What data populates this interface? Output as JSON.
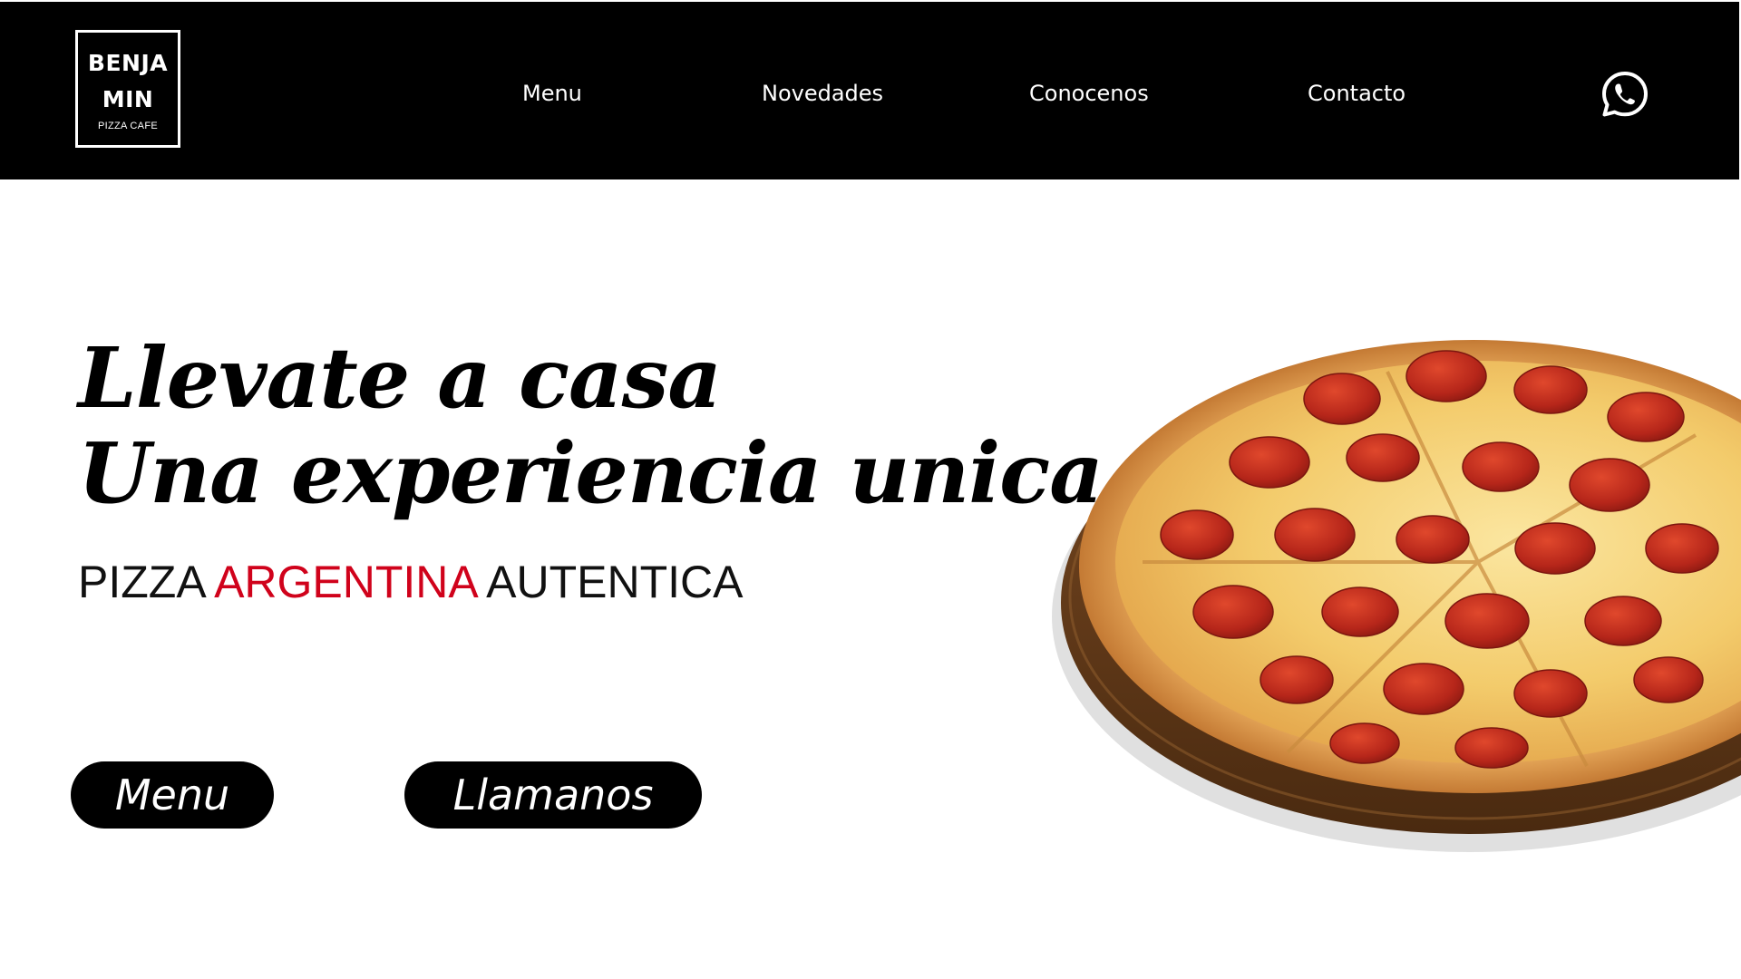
{
  "header": {
    "logo": {
      "line1": "BENJA",
      "line2": "MIN",
      "line3": "PIZZA CAFE"
    },
    "nav": [
      {
        "label": "Menu"
      },
      {
        "label": "Novedades"
      },
      {
        "label": "Conocenos"
      },
      {
        "label": "Contacto"
      }
    ],
    "whatsapp_icon": "whatsapp-icon"
  },
  "hero": {
    "headline_line1": "Llevate a casa",
    "headline_line2": "Una experiencia unica",
    "tagline": {
      "part1": "PIZZA ",
      "highlight": "ARGENTINA",
      "part2": " AUTENTICA"
    },
    "buttons": {
      "menu": "Menu",
      "call": "Llamanos"
    },
    "image": "pepperoni-pizza-image"
  },
  "colors": {
    "header_bg": "#000000",
    "accent_red": "#d0021b",
    "text": "#000000",
    "background": "#ffffff"
  }
}
